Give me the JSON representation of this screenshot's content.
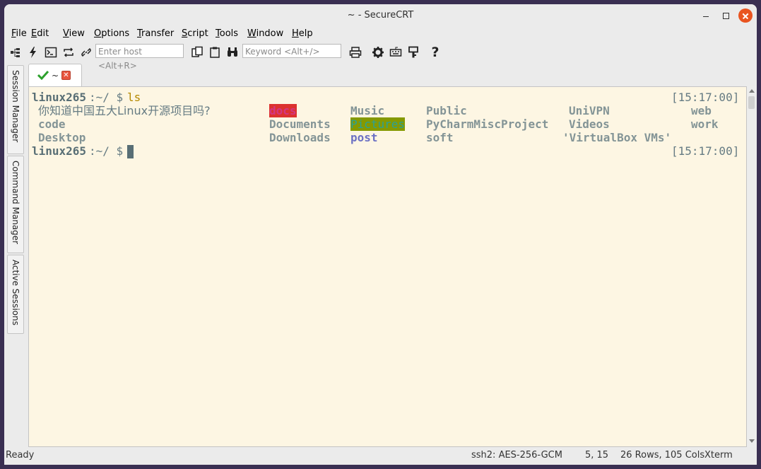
{
  "window": {
    "title": "~ - SecureCRT"
  },
  "menu": [
    "File",
    "Edit",
    "View",
    "Options",
    "Transfer",
    "Script",
    "Tools",
    "Window",
    "Help"
  ],
  "toolbar": {
    "host_placeholder": "Enter host <Alt+R>",
    "keyword_placeholder": "Keyword <Alt+/>",
    "icons": [
      "connect-icon",
      "quick-connect-icon",
      "terminal-icon",
      "reconnect-icon",
      "disconnect-icon",
      "copy-icon",
      "paste-icon",
      "find-icon",
      "print-icon",
      "settings-icon",
      "keymap-icon",
      "key-icon",
      "help-icon"
    ]
  },
  "side_tabs": [
    "Session Manager",
    "Command Manager",
    "Active Sessions"
  ],
  "session_tab": {
    "label": "~",
    "status": "connected",
    "status_color": "#2ca02c"
  },
  "terminal": {
    "prompt_user": "linux265",
    "prompt_path": ":~/ $",
    "command": "ls",
    "timestamp1": "[15:17:00]",
    "timestamp2": "[15:17:00]",
    "entries": {
      "cjk_file": "你知道中国五大Linux开源项目吗?",
      "code": "code",
      "desktop": "Desktop",
      "docs": "docs",
      "documents": "Documents",
      "downloads": "Downloads",
      "music": "Music",
      "pictures": "Pictures",
      "post": "post",
      "public": "Public",
      "pycharm": "PyCharmMiscProject",
      "soft": "soft",
      "univpn": "UniVPN",
      "videos": "Videos",
      "virtualbox": "'VirtualBox VMs'",
      "web": "web",
      "work": "work"
    },
    "colors": {
      "background": "#fdf6e3",
      "docs_highlight": "#dc322f",
      "pictures_highlight": "#859900",
      "post_color": "#6c71c4"
    }
  },
  "status": {
    "state": "Ready",
    "protocol": "ssh2: AES-256-GCM",
    "cursor_pos": "5,  15",
    "size": "26 Rows, 105 Cols",
    "emulation": "Xterm"
  }
}
